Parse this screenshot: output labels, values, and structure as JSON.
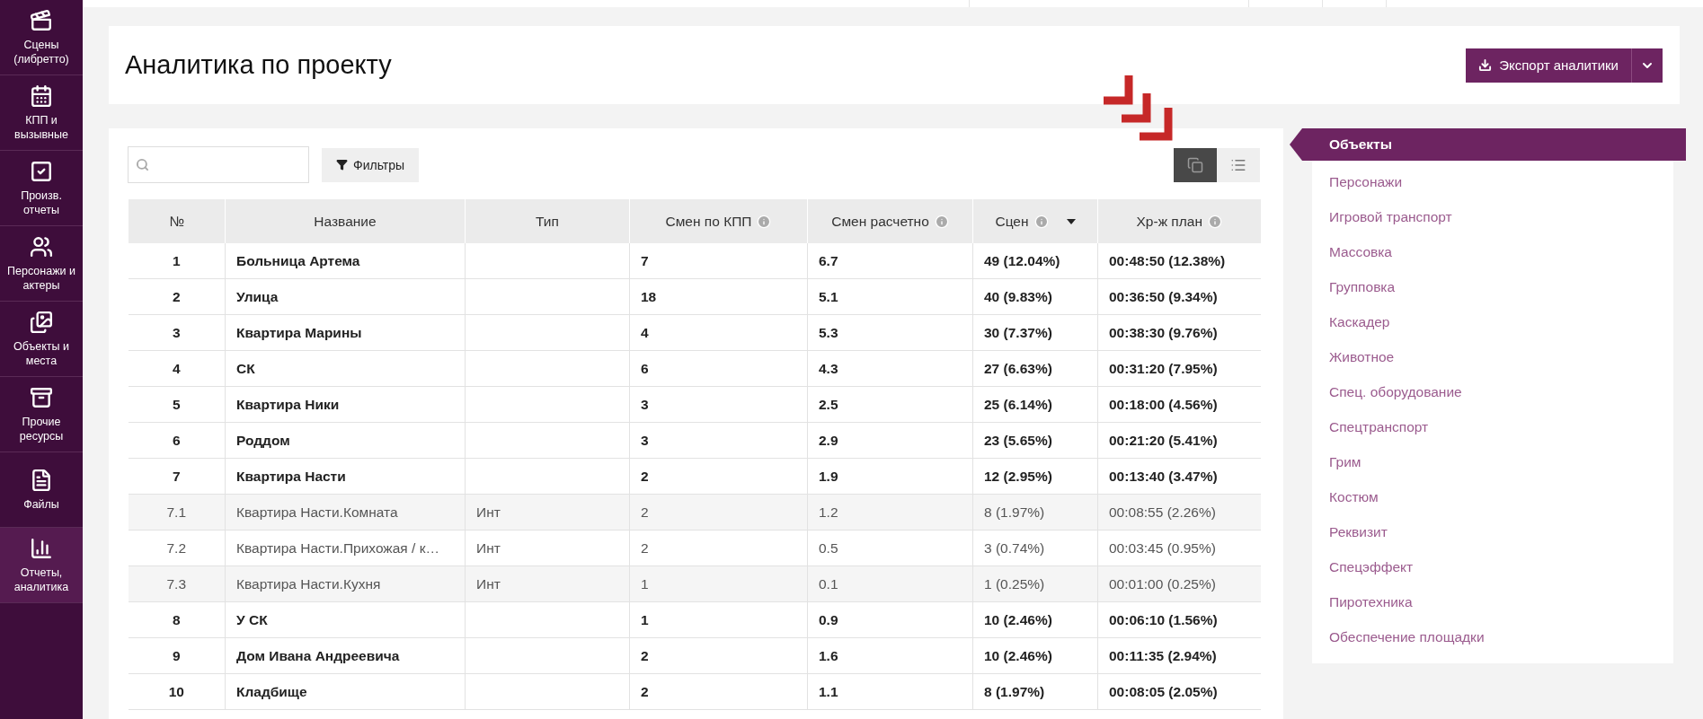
{
  "sidebar": {
    "items": [
      {
        "kind": "scenes",
        "label": "Сцены (либретто)",
        "selected": false
      },
      {
        "kind": "calendar",
        "label": "КПП и вызывные",
        "selected": false
      },
      {
        "kind": "check",
        "label": "Произв. отчеты",
        "selected": false
      },
      {
        "kind": "people",
        "label": "Персонажи и актеры",
        "selected": false
      },
      {
        "kind": "images",
        "label": "Объекты и места",
        "selected": false
      },
      {
        "kind": "archive",
        "label": "Прочие ресурсы",
        "selected": false
      },
      {
        "kind": "file",
        "label": "Файлы",
        "selected": false
      },
      {
        "kind": "chart",
        "label": "Отчеты, аналитика",
        "selected": true
      }
    ]
  },
  "header": {
    "title": "Аналитика по проекту",
    "export_button": "Экспорт аналитики"
  },
  "toolbar": {
    "filter_button": "Фильтры",
    "view_toggle": [
      {
        "kind": "grid",
        "selected": true
      },
      {
        "kind": "list",
        "selected": false
      }
    ]
  },
  "table": {
    "columns": [
      {
        "label": "№",
        "info": false,
        "sorted": false
      },
      {
        "label": "Название",
        "info": false,
        "sorted": false
      },
      {
        "label": "Тип",
        "info": false,
        "sorted": false
      },
      {
        "label": "Смен по КПП",
        "info": true,
        "sorted": false
      },
      {
        "label": "Смен расчетно",
        "info": true,
        "sorted": false
      },
      {
        "label": "Сцен",
        "info": true,
        "sorted": true
      },
      {
        "label": "Хр-ж план",
        "info": true,
        "sorted": false
      }
    ],
    "rows": [
      {
        "kind": "main",
        "cells": [
          "1",
          "Больница Артема",
          "",
          "7",
          "6.7",
          "49 (12.04%)",
          "00:48:50 (12.38%)"
        ]
      },
      {
        "kind": "main",
        "cells": [
          "2",
          "Улица",
          "",
          "18",
          "5.1",
          "40 (9.83%)",
          "00:36:50 (9.34%)"
        ]
      },
      {
        "kind": "main",
        "cells": [
          "3",
          "Квартира Марины",
          "",
          "4",
          "5.3",
          "30 (7.37%)",
          "00:38:30 (9.76%)"
        ]
      },
      {
        "kind": "main",
        "cells": [
          "4",
          "СК",
          "",
          "6",
          "4.3",
          "27 (6.63%)",
          "00:31:20 (7.95%)"
        ]
      },
      {
        "kind": "main",
        "cells": [
          "5",
          "Квартира Ники",
          "",
          "3",
          "2.5",
          "25 (6.14%)",
          "00:18:00 (4.56%)"
        ]
      },
      {
        "kind": "main",
        "cells": [
          "6",
          "Роддом",
          "",
          "3",
          "2.9",
          "23 (5.65%)",
          "00:21:20 (5.41%)"
        ]
      },
      {
        "kind": "main",
        "cells": [
          "7",
          "Квартира Насти",
          "",
          "2",
          "1.9",
          "12 (2.95%)",
          "00:13:40 (3.47%)"
        ]
      },
      {
        "kind": "sub",
        "cells": [
          "7.1",
          "Квартира Насти.Комната",
          "Инт",
          "2",
          "1.2",
          "8 (1.97%)",
          "00:08:55 (2.26%)"
        ]
      },
      {
        "kind": "sub",
        "cells": [
          "7.2",
          "Квартира Насти.Прихожая / к…",
          "Инт",
          "2",
          "0.5",
          "3 (0.74%)",
          "00:03:45 (0.95%)"
        ]
      },
      {
        "kind": "sub",
        "cells": [
          "7.3",
          "Квартира Насти.Кухня",
          "Инт",
          "1",
          "0.1",
          "1 (0.25%)",
          "00:01:00 (0.25%)"
        ]
      },
      {
        "kind": "main",
        "cells": [
          "8",
          "У СК",
          "",
          "1",
          "0.9",
          "10 (2.46%)",
          "00:06:10 (1.56%)"
        ]
      },
      {
        "kind": "main",
        "cells": [
          "9",
          "Дом Ивана Андреевича",
          "",
          "2",
          "1.6",
          "10 (2.46%)",
          "00:11:35 (2.94%)"
        ]
      },
      {
        "kind": "main",
        "cells": [
          "10",
          "Кладбище",
          "",
          "2",
          "1.1",
          "8 (1.97%)",
          "00:08:05 (2.05%)"
        ]
      }
    ]
  },
  "categories": [
    {
      "label": "Объекты",
      "selected": true
    },
    {
      "label": "Персонажи",
      "selected": false
    },
    {
      "label": "Игровой транспорт",
      "selected": false
    },
    {
      "label": "Массовка",
      "selected": false
    },
    {
      "label": "Групповка",
      "selected": false
    },
    {
      "label": "Каскадер",
      "selected": false
    },
    {
      "label": "Животное",
      "selected": false
    },
    {
      "label": "Спец. оборудование",
      "selected": false
    },
    {
      "label": "Спецтранспорт",
      "selected": false
    },
    {
      "label": "Грим",
      "selected": false
    },
    {
      "label": "Костюм",
      "selected": false
    },
    {
      "label": "Реквизит",
      "selected": false
    },
    {
      "label": "Спецэффект",
      "selected": false
    },
    {
      "label": "Пиротехника",
      "selected": false
    },
    {
      "label": "Обеспечение площадки",
      "selected": false
    }
  ]
}
